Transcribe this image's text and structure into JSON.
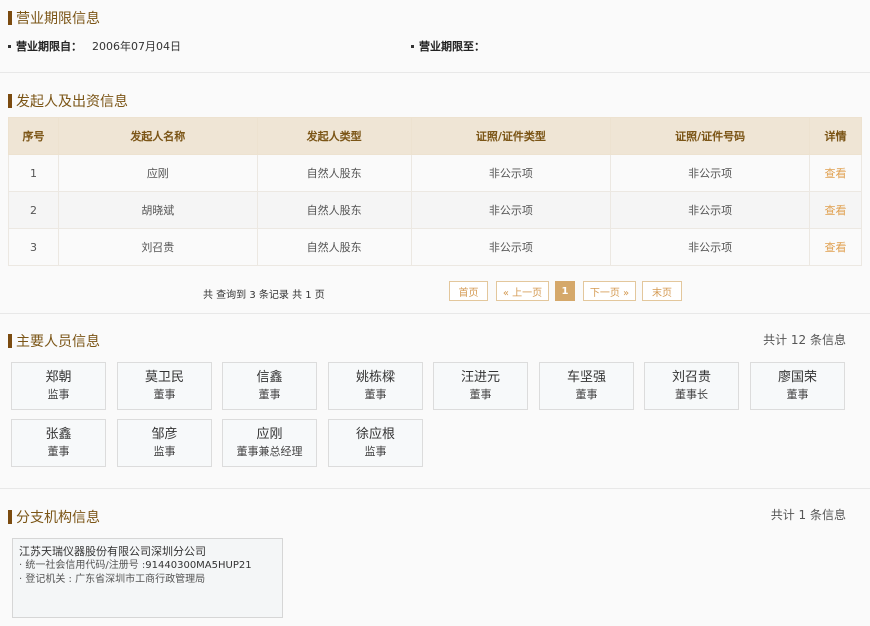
{
  "business_term": {
    "title": "营业期限信息",
    "from_label": "营业期限自：",
    "from_value": "2006年07月04日",
    "to_label": "营业期限至："
  },
  "investors": {
    "title": "发起人及出资信息",
    "columns": [
      "序号",
      "发起人名称",
      "发起人类型",
      "证照/证件类型",
      "证照/证件号码",
      "详情"
    ],
    "rows": [
      {
        "no": "1",
        "name": "应刚",
        "type": "自然人股东",
        "id_type": "非公示项",
        "id_no": "非公示项",
        "detail": "查看"
      },
      {
        "no": "2",
        "name": "胡晓斌",
        "type": "自然人股东",
        "id_type": "非公示项",
        "id_no": "非公示项",
        "detail": "查看"
      },
      {
        "no": "3",
        "name": "刘召贵",
        "type": "自然人股东",
        "id_type": "非公示项",
        "id_no": "非公示项",
        "detail": "查看"
      }
    ],
    "pager": {
      "info": "共 查询到 3 条记录 共 1 页",
      "first": "首页",
      "prev": "« 上一页",
      "current": "1",
      "next": "下一页 »",
      "last": "末页"
    }
  },
  "personnel": {
    "title": "主要人员信息",
    "count": "共计 12 条信息",
    "people": [
      {
        "name": "郑朝",
        "role": "监事"
      },
      {
        "name": "莫卫民",
        "role": "董事"
      },
      {
        "name": "信鑫",
        "role": "董事"
      },
      {
        "name": "姚栋樑",
        "role": "董事"
      },
      {
        "name": "汪进元",
        "role": "董事"
      },
      {
        "name": "车坚强",
        "role": "董事"
      },
      {
        "name": "刘召贵",
        "role": "董事长"
      },
      {
        "name": "廖国荣",
        "role": "董事"
      },
      {
        "name": "张鑫",
        "role": "董事"
      },
      {
        "name": "邹彦",
        "role": "监事"
      },
      {
        "name": "应刚",
        "role": "董事兼总经理"
      },
      {
        "name": "徐应根",
        "role": "监事"
      }
    ]
  },
  "branches": {
    "title": "分支机构信息",
    "count": "共计 1 条信息",
    "items": [
      {
        "name": "江苏天瑞仪器股份有限公司深圳分公司",
        "code_label": "· 统一社会信用代码/注册号 :",
        "code_value": "91440300MA5HUP21",
        "authority_label": "· 登记机关 :",
        "authority_value": "广东省深圳市工商行政管理局"
      }
    ]
  }
}
